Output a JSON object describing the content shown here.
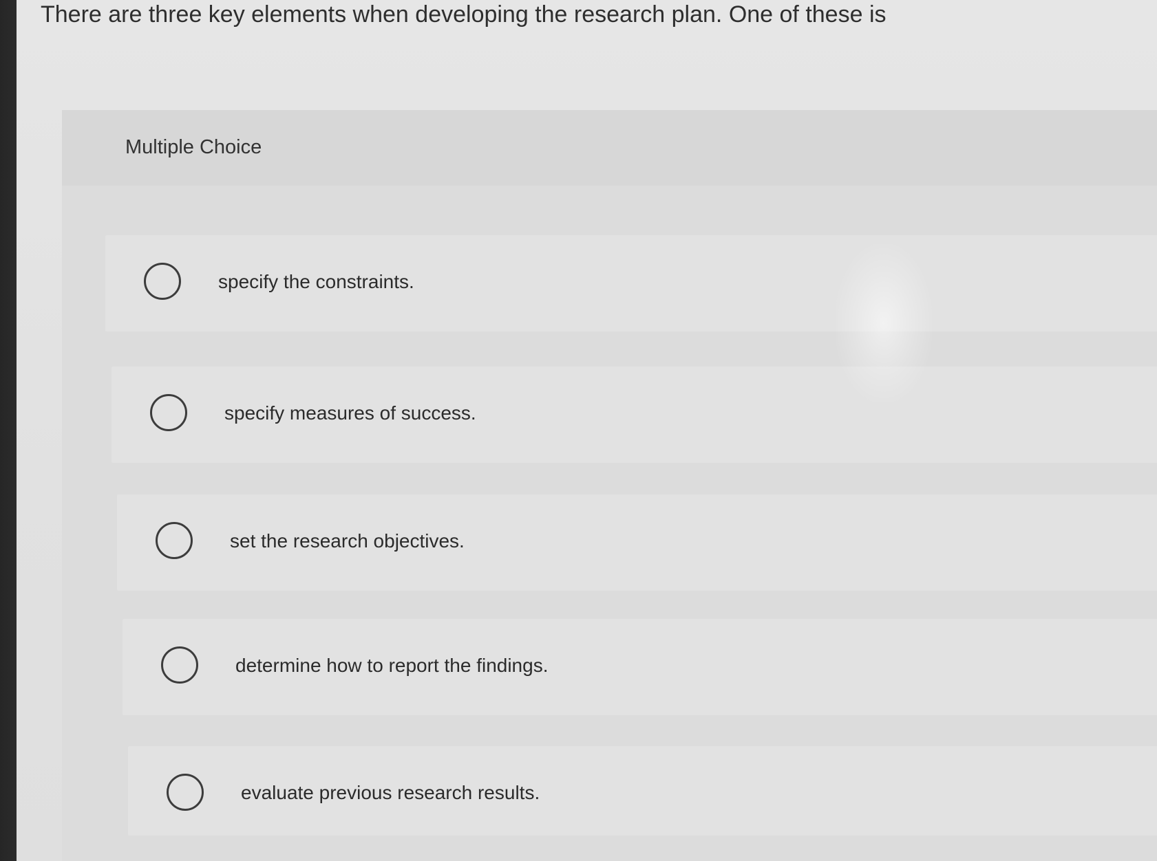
{
  "question": {
    "prompt": "There are three key elements when developing the research plan. One of these is"
  },
  "multiple_choice": {
    "label": "Multiple Choice",
    "options": [
      {
        "text": "specify the constraints.",
        "selected": false
      },
      {
        "text": "specify measures of success.",
        "selected": false
      },
      {
        "text": "set the research objectives.",
        "selected": false
      },
      {
        "text": "determine how to report the findings.",
        "selected": false
      },
      {
        "text": "evaluate previous research results.",
        "selected": false
      }
    ]
  },
  "colors": {
    "page_background": "#e4e4e4",
    "panel_background": "#dcdcdc",
    "option_background": "#e2e2e2",
    "text": "#2e2e2e",
    "radio_border": "#3c3c3c"
  }
}
